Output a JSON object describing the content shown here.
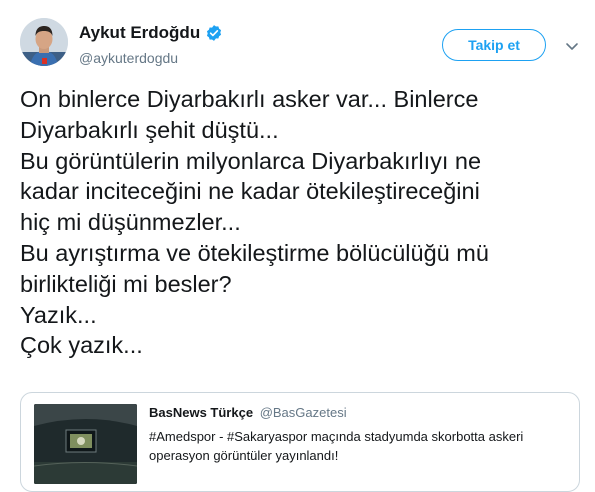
{
  "author": {
    "name": "Aykut Erdoğdu",
    "handle": "@aykuterdogdu",
    "verified_color": "#1da1f2"
  },
  "follow_button": {
    "label": "Takip et",
    "color": "#1da1f2"
  },
  "menu": {
    "icon": "chevron-down-icon"
  },
  "tweet": {
    "lines": [
      "On binlerce Diyarbakırlı asker var... Binlerce",
      "Diyarbakırlı şehit düştü...",
      "Bu görüntülerin milyonlarca Diyarbakırlıyı ne",
      "kadar inciteceğini ne kadar ötekileştireceğini",
      "hiç mi düşünmezler...",
      "Bu ayrıştırma ve ötekileştirme bölücülüğü mü",
      "birlikteliği mi besler?",
      "Yazık...",
      "Çok yazık..."
    ]
  },
  "quoted_tweet": {
    "name": "BasNews Türkçe",
    "handle": "@BasGazetesi",
    "lines": [
      "#Amedspor - #Sakaryaspor maçında stadyumda skorbotta askeri",
      "operasyon görüntüler yayınlandı!"
    ]
  }
}
